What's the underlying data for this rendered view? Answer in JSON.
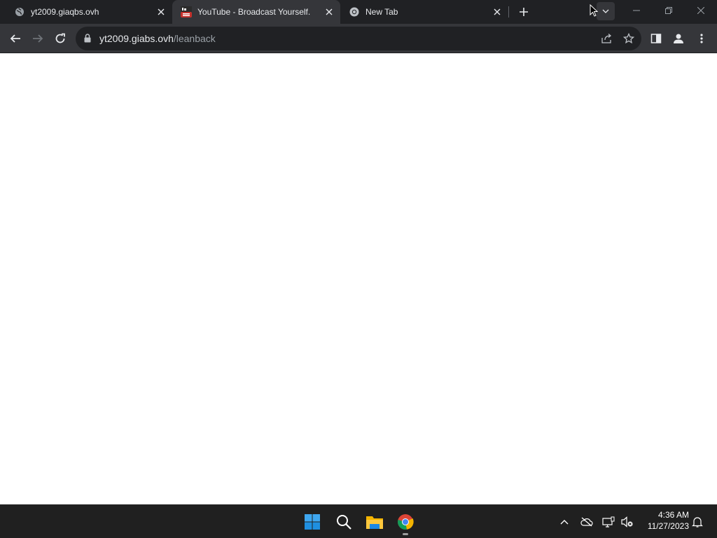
{
  "browser": {
    "tabs": [
      {
        "title": "yt2009.giaqbs.ovh",
        "favicon": "globe-icon",
        "active": false
      },
      {
        "title": "YouTube - Broadcast Yourself.",
        "favicon": "youtube-logo-icon",
        "active": true
      },
      {
        "title": "New Tab",
        "favicon": "chrome-icon",
        "active": false
      }
    ],
    "address": {
      "host": "yt2009.giabs.ovh",
      "path": "/leanback"
    }
  },
  "taskbar": {
    "clock_time": "4:36 AM",
    "clock_date": "11/27/2023"
  },
  "colors": {
    "titlebar": "#202124",
    "toolbar": "#35363a",
    "omnibox": "#202124",
    "taskbar": "#202020",
    "page": "#ffffff"
  }
}
